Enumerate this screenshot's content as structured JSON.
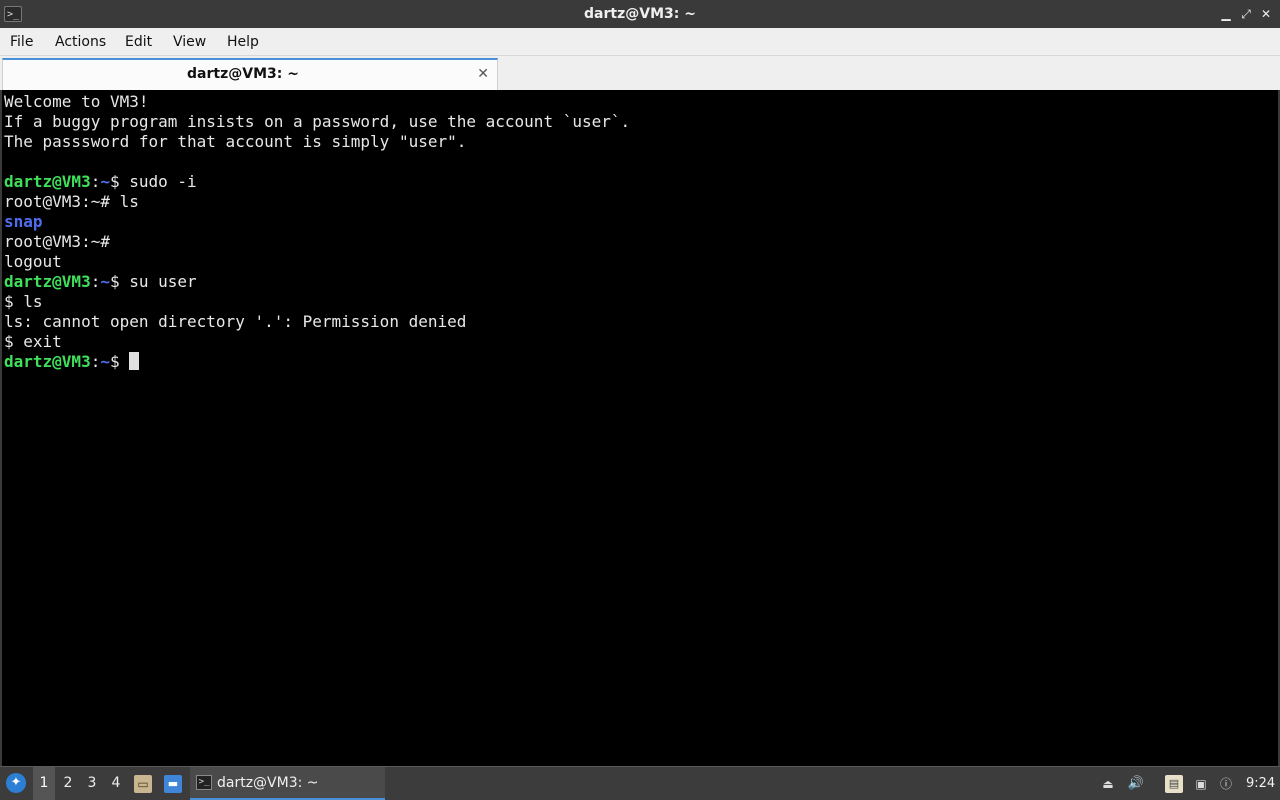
{
  "window": {
    "title": "dartz@VM3: ~",
    "app_icon": "terminal-icon",
    "controls": {
      "minimize": "▁",
      "maximize": "⤢",
      "close": "✕"
    }
  },
  "menu": {
    "items": [
      "File",
      "Actions",
      "Edit",
      "View",
      "Help"
    ]
  },
  "tabs": [
    {
      "label": "dartz@VM3: ~",
      "close": "✕"
    }
  ],
  "terminal": {
    "lines": [
      [
        {
          "text": "Welcome to VM3!",
          "style": "plain"
        }
      ],
      [
        {
          "text": "If a buggy program insists on a password, use the account `user`.",
          "style": "plain"
        }
      ],
      [
        {
          "text": "The passsword for that account is simply \"user\".",
          "style": "plain"
        }
      ],
      [],
      [
        {
          "text": "dartz@VM3",
          "style": "user"
        },
        {
          "text": ":",
          "style": "plain"
        },
        {
          "text": "~",
          "style": "dir"
        },
        {
          "text": "$ sudo -i",
          "style": "plain"
        }
      ],
      [
        {
          "text": "root@VM3:~# ls",
          "style": "plain"
        }
      ],
      [
        {
          "text": "snap",
          "style": "direntry"
        }
      ],
      [
        {
          "text": "root@VM3:~#",
          "style": "plain"
        }
      ],
      [
        {
          "text": "logout",
          "style": "plain"
        }
      ],
      [
        {
          "text": "dartz@VM3",
          "style": "user"
        },
        {
          "text": ":",
          "style": "plain"
        },
        {
          "text": "~",
          "style": "dir"
        },
        {
          "text": "$ su user",
          "style": "plain"
        }
      ],
      [
        {
          "text": "$ ls",
          "style": "plain"
        }
      ],
      [
        {
          "text": "ls: cannot open directory '.': Permission denied",
          "style": "plain"
        }
      ],
      [
        {
          "text": "$ exit",
          "style": "plain"
        }
      ],
      [
        {
          "text": "dartz@VM3",
          "style": "user"
        },
        {
          "text": ":",
          "style": "plain"
        },
        {
          "text": "~",
          "style": "dir"
        },
        {
          "text": "$ ",
          "style": "plain"
        },
        {
          "text": "",
          "style": "cursor"
        }
      ]
    ],
    "colors": {
      "background": "#000000",
      "foreground": "#e8e8e8",
      "prompt_user": "#3fe05a",
      "prompt_dir": "#4f6df0"
    }
  },
  "taskbar": {
    "desktops": [
      "1",
      "2",
      "3",
      "4"
    ],
    "active_desktop": "1",
    "task_label": "dartz@VM3: ~",
    "clock": "9:24"
  }
}
